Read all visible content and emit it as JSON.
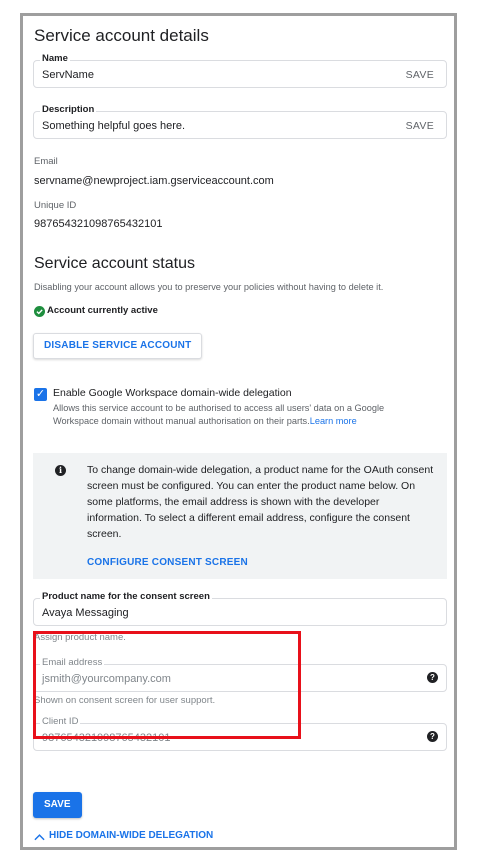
{
  "page_title": "Service account details",
  "name_field": {
    "legend": "Name",
    "value": "ServName",
    "save_label": "SAVE"
  },
  "description_field": {
    "legend": "Description",
    "value": "Something helpful goes here.",
    "save_label": "SAVE"
  },
  "email": {
    "label": "Email",
    "value": "servname@newproject.iam.gserviceaccount.com"
  },
  "unique_id": {
    "label": "Unique ID",
    "value": "987654321098765432101"
  },
  "status": {
    "heading": "Service account status",
    "description": "Disabling your account allows you to preserve your policies without having to delete it.",
    "active_text": "Account currently active",
    "disable_button": "DISABLE SERVICE ACCOUNT"
  },
  "delegation": {
    "checkbox_label": "Enable Google Workspace domain-wide delegation",
    "help_line1": "Allows this service account to be authorised to access all users' data on a Google",
    "help_line2": "Workspace domain without manual authorisation on their parts.",
    "learn_more": "Learn more",
    "info_text": "To change domain-wide delegation, a product name for the OAuth consent screen must be configured. You can enter the product name below. On some platforms, the email address is shown with the developer information. To select a different email address, configure the consent screen.",
    "configure_link": "CONFIGURE CONSENT SCREEN"
  },
  "product_name": {
    "legend": "Product name for the consent screen",
    "value": "Avaya Messaging",
    "hint": "Assign product name."
  },
  "email_address": {
    "legend": "Email address",
    "value": "jsmith@yourcompany.com",
    "hint": "Shown on consent screen for user support."
  },
  "client_id": {
    "legend": "Client ID",
    "value": "987654321098765432101"
  },
  "save_button": "SAVE",
  "hide_delegation": "HIDE DOMAIN-WIDE DELEGATION",
  "colors": {
    "accent": "#1a73e8",
    "success": "#1e8e3e",
    "highlight": "#e8101a"
  }
}
